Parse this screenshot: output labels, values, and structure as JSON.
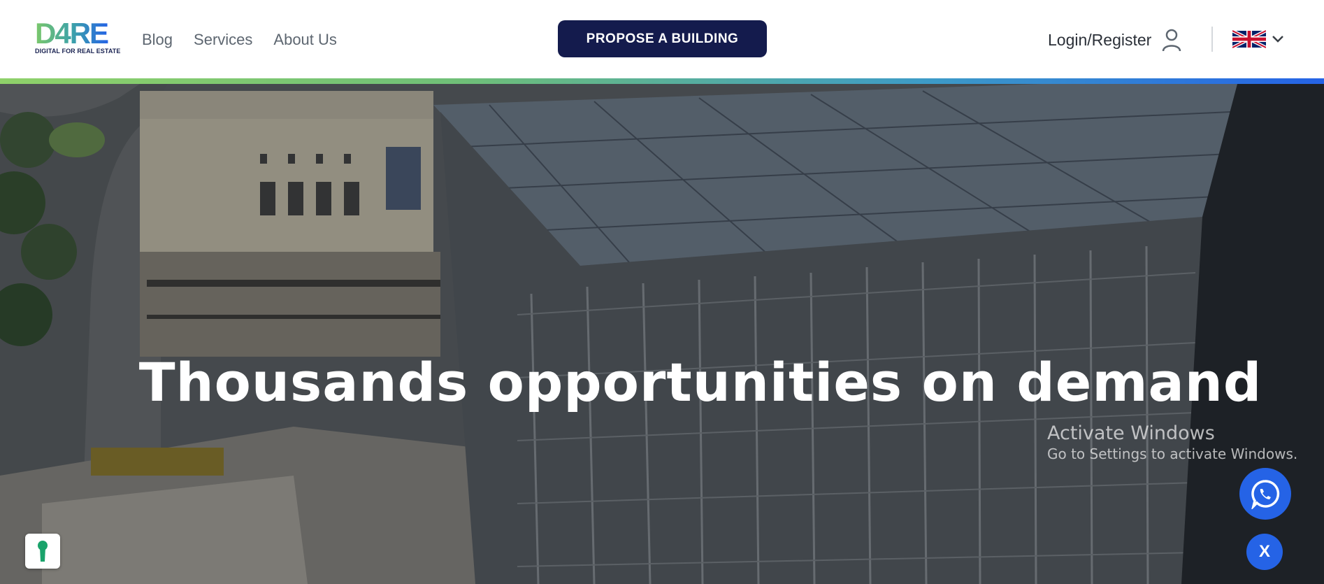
{
  "brand": {
    "logo_text": "D4RE",
    "tagline": "DIGITAL FOR REAL ESTATE"
  },
  "nav": {
    "items": [
      {
        "label": "Blog"
      },
      {
        "label": "Services"
      },
      {
        "label": "About Us"
      }
    ]
  },
  "header": {
    "cta_label": "PROPOSE A BUILDING",
    "login_label": "Login/Register",
    "language": "en-GB"
  },
  "hero": {
    "title": "Thousands opportunities on demand"
  },
  "watermark": {
    "title": "Activate Windows",
    "subtitle": "Go to Settings to activate Windows."
  },
  "widgets": {
    "close_label": "X"
  },
  "icons": {
    "user": "user-icon",
    "flag": "uk-flag-icon",
    "chevron": "chevron-down-icon",
    "whatsapp": "whatsapp-icon",
    "cookie": "keyhole-icon"
  },
  "colors": {
    "cta_bg": "#141b4d",
    "accent_blue": "#2563e6",
    "accent_green": "#8fd16a",
    "logo_green": "#7cc86a",
    "logo_blue": "#2563e6"
  }
}
